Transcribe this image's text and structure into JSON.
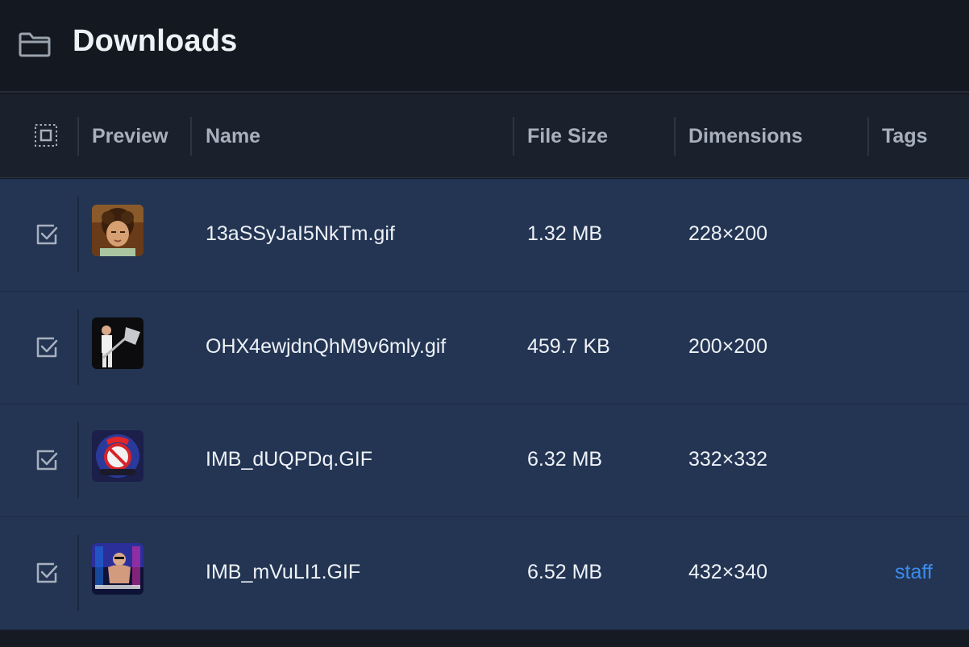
{
  "window": {
    "title": "Downloads",
    "title_icon": "folder-icon"
  },
  "columns": {
    "select_all_icon": "select-all-icon",
    "preview": "Preview",
    "name": "Name",
    "file_size": "File Size",
    "dimensions": "Dimensions",
    "tags": "Tags"
  },
  "rows": [
    {
      "checked": true,
      "thumbnail": "curly-hair-man-photo",
      "name": "13aSSyJaI5NkTm.gif",
      "file_size": "1.32 MB",
      "dimensions": "228×200",
      "tags": ""
    },
    {
      "checked": true,
      "thumbnail": "man-with-shovel-photo",
      "name": "OHX4ewjdnQhM9v6mly.gif",
      "file_size": "459.7 KB",
      "dimensions": "200×200",
      "tags": ""
    },
    {
      "checked": true,
      "thumbnail": "anti-badge-logo",
      "name": "IMB_dUQPDq.GIF",
      "file_size": "6.32 MB",
      "dimensions": "332×332",
      "tags": ""
    },
    {
      "checked": true,
      "thumbnail": "neon-poster-photo",
      "name": "IMB_mVuLI1.GIF",
      "file_size": "6.52 MB",
      "dimensions": "432×340",
      "tags": "staff"
    }
  ],
  "colors": {
    "background": "#141820",
    "header": "#1b212c",
    "row_selected": "#233553",
    "tag_link": "#3a8df0"
  }
}
